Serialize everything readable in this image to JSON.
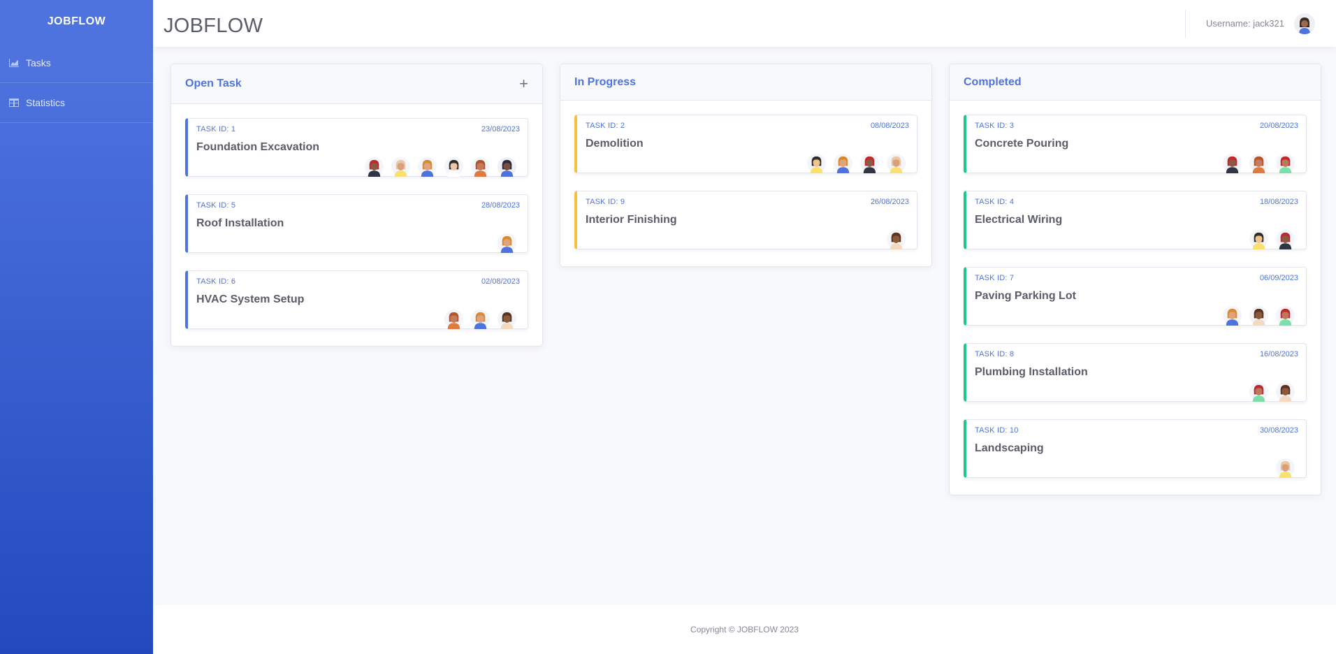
{
  "brand": "JOBFLOW",
  "sidebar": {
    "items": [
      {
        "label": "Tasks",
        "icon": "chart-area-icon"
      },
      {
        "label": "Statistics",
        "icon": "table-icon"
      }
    ]
  },
  "header": {
    "title": "JOBFLOW",
    "username": "Username: jack321"
  },
  "colors": {
    "primary": "#4e73df",
    "open": "#4e73df",
    "in_progress": "#f6c23e",
    "completed": "#1cc88a"
  },
  "columns": [
    {
      "title": "Open Task",
      "add_label": "+",
      "variant": "open",
      "tasks": [
        {
          "id": "TASK ID: 1",
          "date": "23/08/2023",
          "name": "Foundation Excavation",
          "avatars": [
            "red-cap-man",
            "bald-man",
            "blonde-woman",
            "dark-hair-woman",
            "curly-woman",
            "dark-woman"
          ]
        },
        {
          "id": "TASK ID: 5",
          "date": "28/08/2023",
          "name": "Roof Installation",
          "avatars": [
            "blonde-woman"
          ]
        },
        {
          "id": "TASK ID: 6",
          "date": "02/08/2023",
          "name": "HVAC System Setup",
          "avatars": [
            "curly-woman",
            "blonde-woman",
            "afro-man"
          ]
        }
      ]
    },
    {
      "title": "In Progress",
      "variant": "progress",
      "tasks": [
        {
          "id": "TASK ID: 2",
          "date": "08/08/2023",
          "name": "Demolition",
          "avatars": [
            "yellow-man",
            "blonde-woman",
            "red-cap-man",
            "bald-man"
          ]
        },
        {
          "id": "TASK ID: 9",
          "date": "26/08/2023",
          "name": "Interior Finishing",
          "avatars": [
            "afro-man"
          ]
        }
      ]
    },
    {
      "title": "Completed",
      "variant": "done",
      "tasks": [
        {
          "id": "TASK ID: 3",
          "date": "20/08/2023",
          "name": "Concrete Pouring",
          "avatars": [
            "red-cap-man",
            "curly-woman",
            "green-shirt-man"
          ]
        },
        {
          "id": "TASK ID: 4",
          "date": "18/08/2023",
          "name": "Electrical Wiring",
          "avatars": [
            "yellow-man",
            "red-cap-man"
          ]
        },
        {
          "id": "TASK ID: 7",
          "date": "06/09/2023",
          "name": "Paving Parking Lot",
          "avatars": [
            "blonde-woman",
            "afro-man",
            "green-shirt-man"
          ]
        },
        {
          "id": "TASK ID: 8",
          "date": "16/08/2023",
          "name": "Plumbing Installation",
          "avatars": [
            "green-shirt-man",
            "afro-man"
          ]
        },
        {
          "id": "TASK ID: 10",
          "date": "30/08/2023",
          "name": "Landscaping",
          "avatars": [
            "bald-man"
          ]
        }
      ]
    }
  ],
  "footer": {
    "copyright": "Copyright © JOBFLOW 2023"
  }
}
